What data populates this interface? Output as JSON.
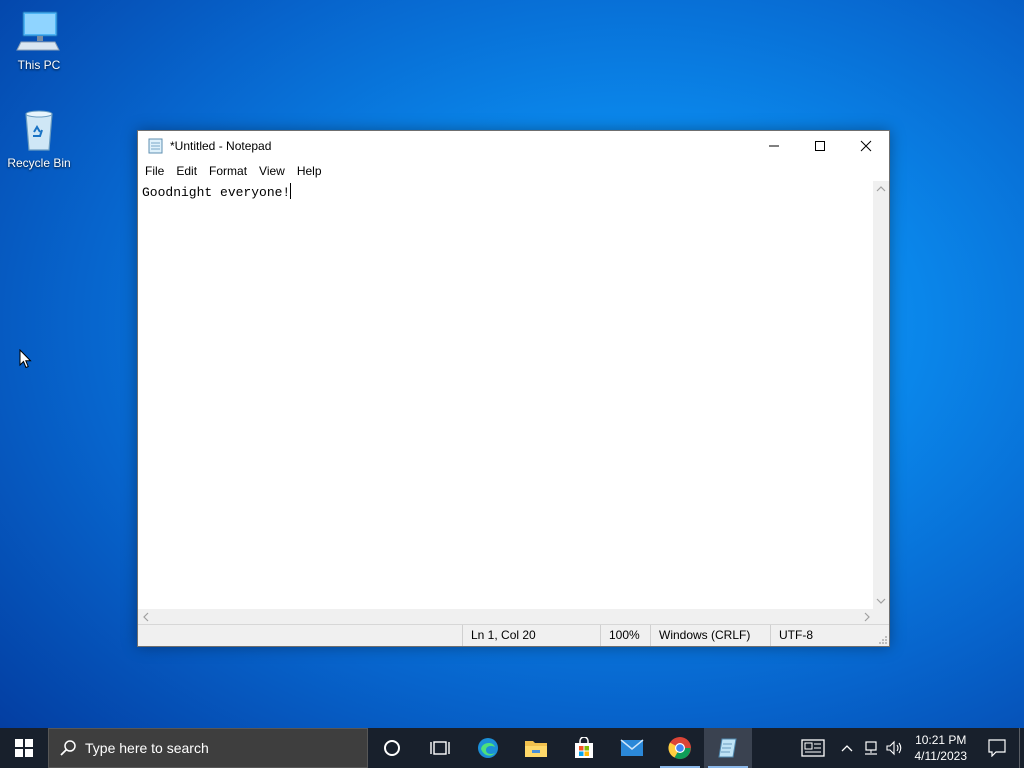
{
  "desktop": {
    "icons": [
      {
        "label": "This PC"
      },
      {
        "label": "Recycle Bin"
      }
    ]
  },
  "notepad": {
    "title": "*Untitled - Notepad",
    "menu": [
      "File",
      "Edit",
      "Format",
      "View",
      "Help"
    ],
    "content": "Goodnight everyone!",
    "status": {
      "position": "Ln 1, Col 20",
      "zoom": "100%",
      "line_ending": "Windows (CRLF)",
      "encoding": "UTF-8"
    }
  },
  "taskbar": {
    "search_placeholder": "Type here to search",
    "apps": [
      "cortana-icon",
      "task-view-icon",
      "edge-icon",
      "file-explorer-icon",
      "store-icon",
      "mail-icon",
      "chrome-icon",
      "notepad-icon"
    ],
    "clock_time": "10:21 PM",
    "clock_date": "4/11/2023"
  },
  "colors": {
    "taskbar_bg": "#18202c",
    "desktop_accent": "#0a86ea"
  }
}
